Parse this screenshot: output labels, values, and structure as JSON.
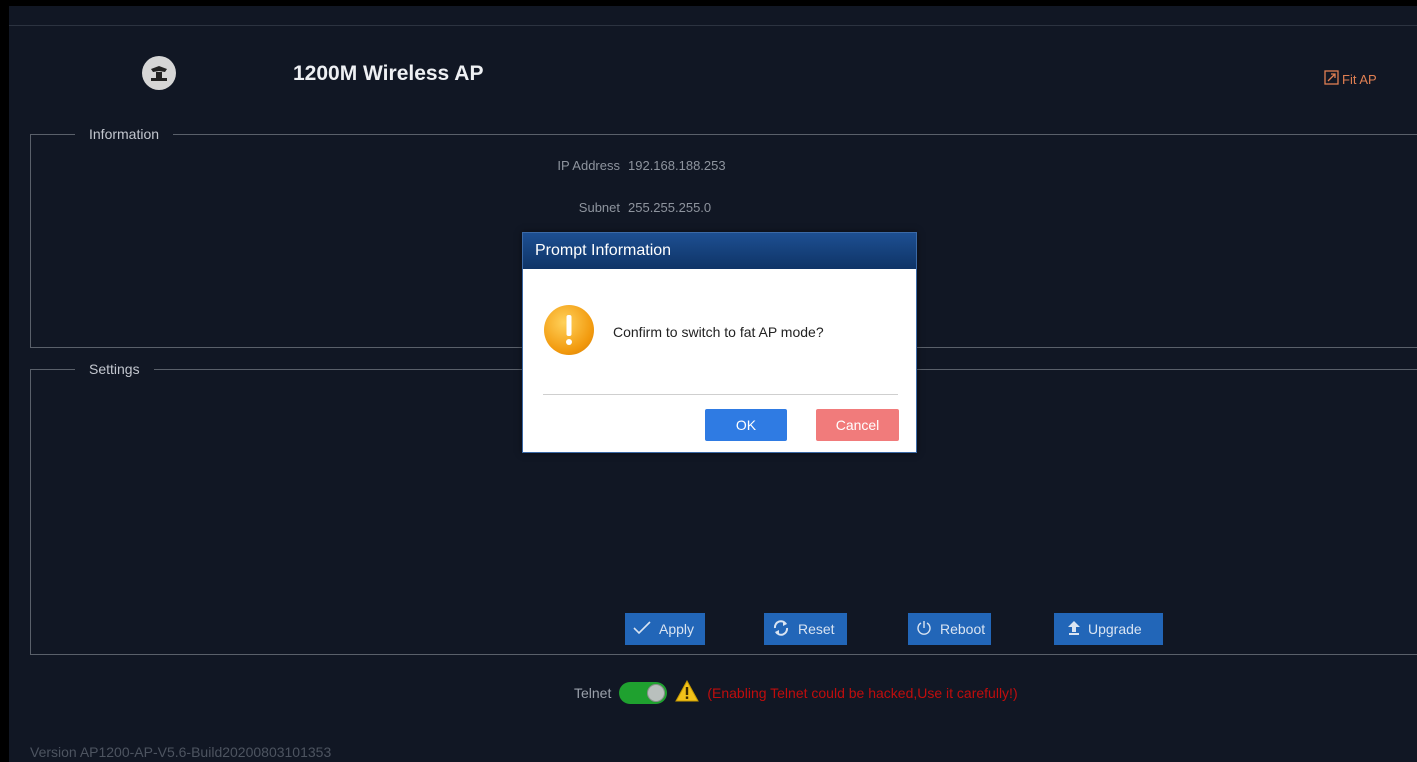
{
  "header": {
    "title": "1200M Wireless AP",
    "mode_link": "Fit AP"
  },
  "information": {
    "legend": "Information",
    "rows": [
      {
        "label": "IP Address",
        "value": "192.168.188.253"
      },
      {
        "label": "Subnet",
        "value": "255.255.255.0"
      }
    ]
  },
  "settings": {
    "legend": "Settings",
    "buttons": {
      "apply": "Apply",
      "reset": "Reset",
      "reboot": "Reboot",
      "upgrade": "Upgrade"
    }
  },
  "telnet": {
    "label": "Telnet",
    "enabled": true,
    "warning": "(Enabling Telnet could be hacked,Use it carefully!)"
  },
  "footer": {
    "version": "Version AP1200-AP-V5.6-Build20200803101353"
  },
  "dialog": {
    "title": "Prompt Information",
    "message": "Confirm to switch to fat AP mode?",
    "ok": "OK",
    "cancel": "Cancel"
  },
  "colors": {
    "background": "#111724",
    "button_blue": "#2266b8",
    "warning_red": "#c00d0d",
    "fit_ap_orange": "#e07f52",
    "ok_blue": "#2f7be3",
    "cancel_red": "#f17b7b",
    "toggle_green": "#1fa12f"
  }
}
